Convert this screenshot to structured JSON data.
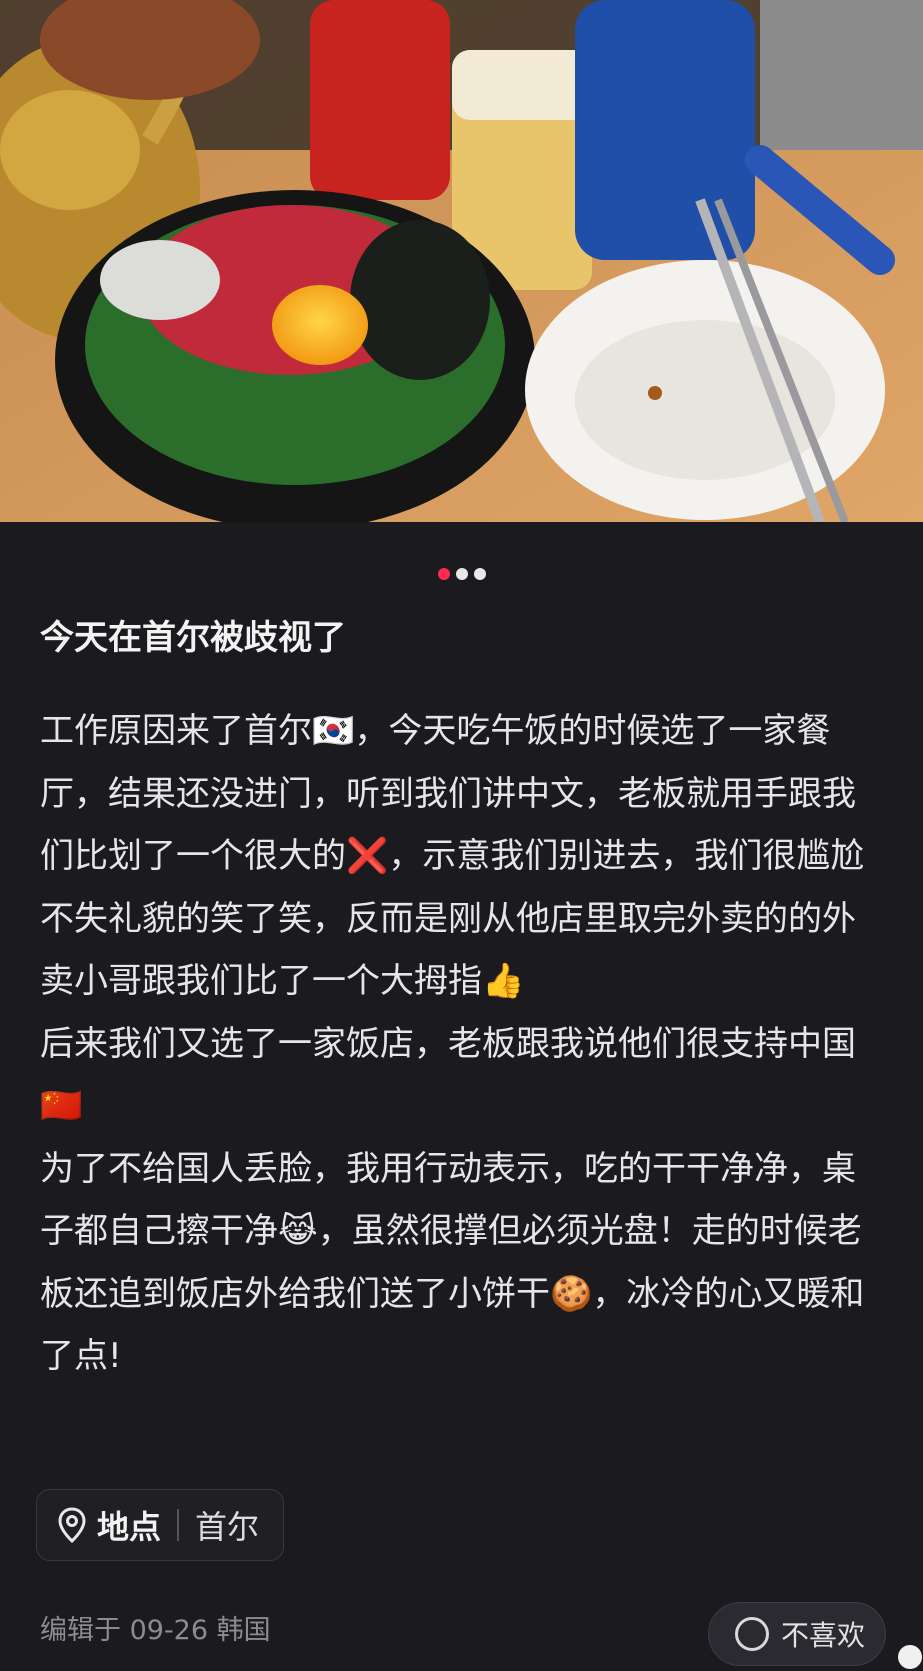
{
  "carousel": {
    "dot_count": 3,
    "active_index": 0
  },
  "post": {
    "title": "今天在首尔被歧视了",
    "paragraphs": [
      "工作原因来了首尔🇰🇷，今天吃午饭的时候选了一家餐厅，结果还没进门，听到我们讲中文，老板就用手跟我们比划了一个很大的❌，示意我们别进去，我们很尴尬不失礼貌的笑了笑，反而是刚从他店里取完外卖的的外卖小哥跟我们比了一个大拇指👍",
      "后来我们又选了一家饭店，老板跟我说他们很支持中国🇨🇳",
      "为了不给国人丢脸，我用行动表示，吃的干干净净，桌子都自己擦干净😹，虽然很撑但必须光盘！走的时候老板还追到饭店外给我们送了小饼干🍪，冰冷的心又暖和了点!"
    ]
  },
  "location": {
    "label": "地点",
    "value": "首尔",
    "icon": "location-pin-icon"
  },
  "meta": {
    "edited": "编辑于  09-26  韩国"
  },
  "floating_button": {
    "label": "不喜欢",
    "icon": "dislike-icon"
  },
  "colors": {
    "background": "#1b1b1f",
    "accent": "#ff2a50"
  }
}
